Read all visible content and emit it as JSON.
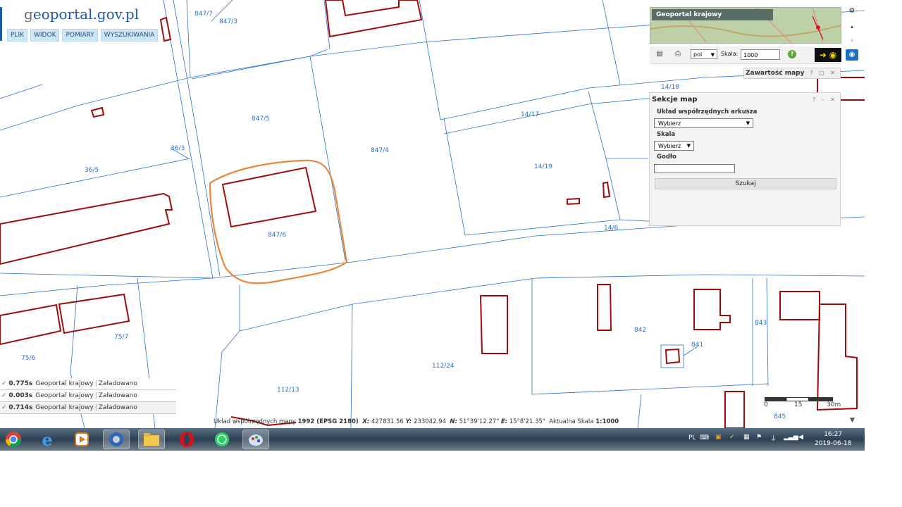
{
  "site": {
    "logo_g": "g",
    "logo_rest": "eoportal.gov.pl"
  },
  "menu": [
    {
      "label": "PLIK"
    },
    {
      "label": "WIDOK"
    },
    {
      "label": "POMIARY"
    },
    {
      "label": "WYSZUKIWANIA"
    }
  ],
  "minimap": {
    "title": "Geoportal krajowy"
  },
  "toolbar": {
    "language": "pol",
    "scale_label": "Skala:",
    "scale_value": "1000",
    "help": "?"
  },
  "content_panel": {
    "title": "Zawartość mapy"
  },
  "dialog": {
    "title": "Sekcje map",
    "coord_label": "Układ współrzędnych arkusza",
    "coord_value": "Wybierz",
    "scale_label": "Skala",
    "scale_value": "Wybierz",
    "godlo_label": "Godło",
    "godlo_value": "",
    "search_button": "Szukaj",
    "window_buttons": "? – ✕"
  },
  "parcels": [
    "847/7",
    "847/3",
    "847/5",
    "847/4",
    "847/6",
    "36/3",
    "36/5",
    "14/18",
    "14/17",
    "14/19",
    "14/6",
    "75/7",
    "75/6",
    "112/24",
    "112/13",
    "842",
    "843",
    "841",
    "845"
  ],
  "status_log": [
    {
      "time": "0.775s",
      "source": "Geoportal krajowy",
      "status": "Załadowano"
    },
    {
      "time": "0.003s",
      "source": "Geoportal krajowy",
      "status": "Załadowano"
    },
    {
      "time": "0.714s",
      "source": "Geoportal krajowy",
      "status": "Załadowano"
    }
  ],
  "coords": {
    "prefix": "Układ współrzędnych mapy",
    "system": "1992 (EPSG 2180)",
    "x_label": "X:",
    "x": "427831.56",
    "y_label": "Y:",
    "y": "233042.94",
    "n_label": "N:",
    "n": "51°39'12.27\"",
    "e_label": "E:",
    "e": "15°8'21.35\"",
    "scale_prefix": "Aktualna Skala",
    "scale": "1:1000"
  },
  "scale_bar": {
    "t0": "0",
    "t1": "15",
    "t2": "30m"
  },
  "tray": {
    "lang": "PL",
    "time": "16:27",
    "date": "2019-06-18"
  },
  "colors": {
    "parcel_line": "#2a6fd6",
    "building": "#9b0d0d",
    "highlight": "#e8873a",
    "taskbar": "#2d3f52"
  }
}
